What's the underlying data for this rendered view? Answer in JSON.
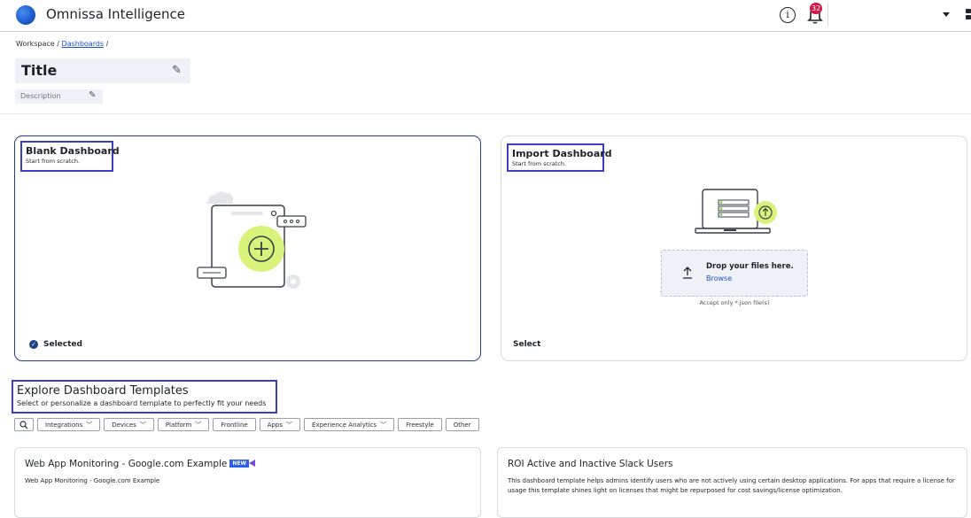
{
  "app": {
    "title": "Omnissa Intelligence",
    "notification_count": "32"
  },
  "breadcrumb": {
    "root": "Workspace",
    "separator": "/",
    "link": "Dashboards",
    "trailing": "/"
  },
  "header": {
    "title": "Title",
    "description_placeholder": "Description"
  },
  "cards": {
    "blank": {
      "title": "Blank Dashboard",
      "subtitle": "Start from scratch.",
      "status": "Selected"
    },
    "import": {
      "title": "Import Dashboard",
      "subtitle": "Start from scratch.",
      "drop_title": "Drop your files here.",
      "drop_link": "Browse",
      "accept": "Accept only *.json file(s)",
      "action": "Select"
    }
  },
  "templates": {
    "title": "Explore Dashboard Templates",
    "subtitle": "Select or personalize a dashboard template to perfectly fit your needs",
    "filters": [
      "Integrations",
      "Devices",
      "Platform",
      "Frontline",
      "Apps",
      "Experience Analytics",
      "Freestyle",
      "Other"
    ],
    "items": [
      {
        "title": "Web App Monitoring - Google.com Example",
        "badge": "NEW",
        "description": "Web App Monitoring - Google.com Example"
      },
      {
        "title": "ROI Active and Inactive Slack Users",
        "description": "This dashboard template helps admins identify users who are not actively using certain desktop applications. For apps that require a license for usage this template shines light on licenses that might be repurposed for cost savings/license optimization."
      }
    ]
  },
  "colors": {
    "accent": "#1f3f86",
    "link": "#1f4ec7",
    "highlight_box": "#3a3fc4",
    "plus_green": "#d9f27a",
    "badge_red": "#d0184a"
  }
}
